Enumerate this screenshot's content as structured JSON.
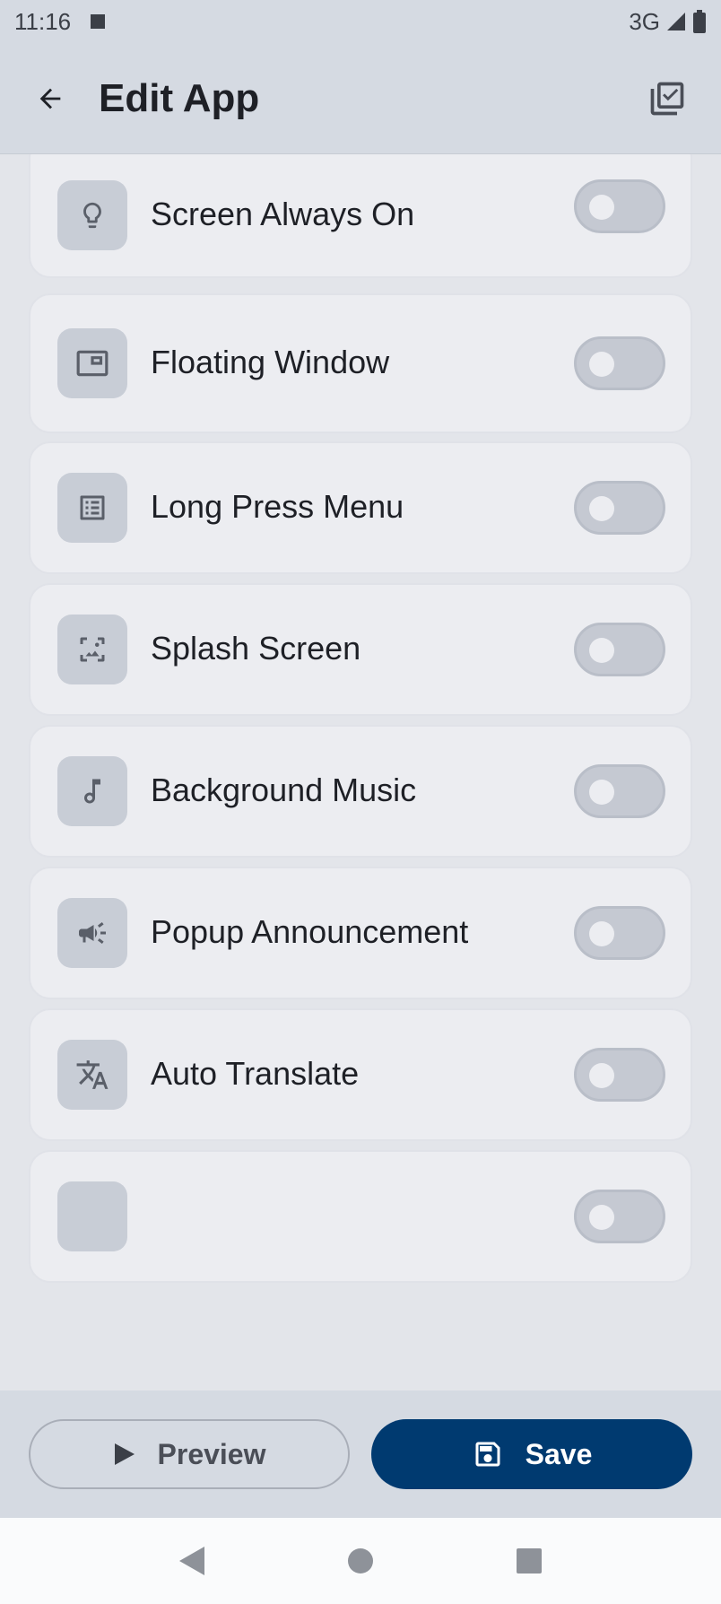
{
  "status_bar": {
    "time": "11:16",
    "network": "3G"
  },
  "header": {
    "title": "Edit App"
  },
  "settings": [
    {
      "label": "Screen Always On",
      "icon": "lightbulb-icon",
      "enabled": false
    },
    {
      "label": "Floating Window",
      "icon": "floating-window-icon",
      "enabled": false
    },
    {
      "label": "Long Press Menu",
      "icon": "list-menu-icon",
      "enabled": false
    },
    {
      "label": "Splash Screen",
      "icon": "image-icon",
      "enabled": false
    },
    {
      "label": "Background Music",
      "icon": "music-note-icon",
      "enabled": false
    },
    {
      "label": "Popup Announcement",
      "icon": "megaphone-icon",
      "enabled": false
    },
    {
      "label": "Auto Translate",
      "icon": "translate-icon",
      "enabled": false
    }
  ],
  "footer": {
    "preview_label": "Preview",
    "save_label": "Save"
  },
  "colors": {
    "primary": "#003A70",
    "surface": "#ECEDF1",
    "toggle_off": "#C5C9D2"
  }
}
